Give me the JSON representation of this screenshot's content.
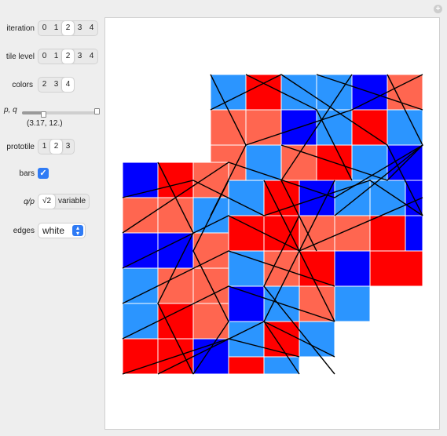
{
  "controls": {
    "iteration": {
      "label": "iteration",
      "options": [
        "0",
        "1",
        "2",
        "3",
        "4"
      ],
      "selected": "2"
    },
    "tile_level": {
      "label": "tile level",
      "options": [
        "0",
        "1",
        "2",
        "3",
        "4"
      ],
      "selected": "2"
    },
    "colors": {
      "label": "colors",
      "options": [
        "2",
        "3",
        "4"
      ],
      "selected": "4"
    },
    "pq": {
      "label": "p, q",
      "value_text": "(3.17, 12.)"
    },
    "prototile": {
      "label": "prototile",
      "options": [
        "1",
        "2",
        "3"
      ],
      "selected": "2"
    },
    "bars": {
      "label": "bars",
      "checked": true
    },
    "q_over_p": {
      "label": "q/p",
      "options": [
        "√2",
        "variable"
      ],
      "selected": "√2"
    },
    "edges": {
      "label": "edges",
      "value": "white"
    }
  },
  "colors": {
    "red": "#ff0000",
    "blue": "#0000ff",
    "lightblue": "#2b95ff",
    "salmon": "#ff6650",
    "selected_accent": "#2f7bf5"
  },
  "icons": {
    "window": "plus-circle-icon",
    "dropdown": "up-down-chevron-icon",
    "check": "checkmark-icon"
  }
}
